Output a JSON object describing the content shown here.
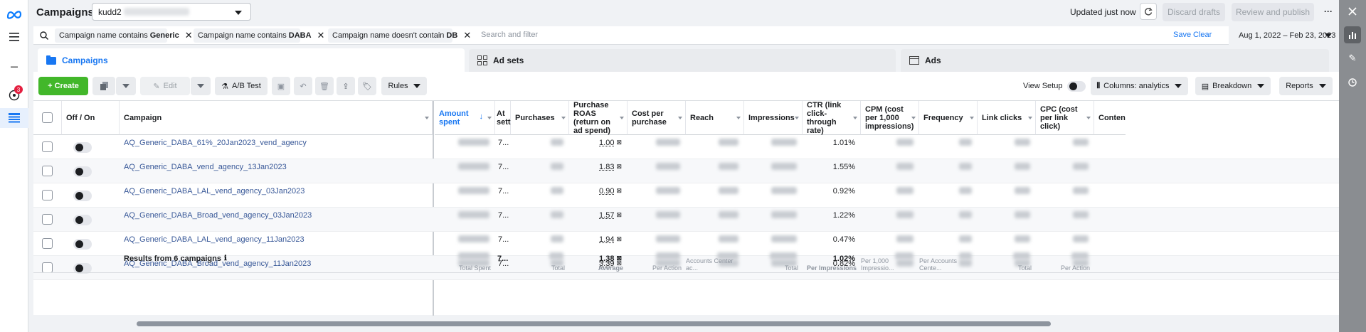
{
  "app": {
    "title": "Campaigns",
    "account": "kudd2",
    "updated": "Updated just now"
  },
  "actions": {
    "discard": "Discard drafts",
    "review": "Review and publish",
    "more": "···"
  },
  "filters": [
    {
      "prefix": "Campaign name contains",
      "value": "Generic"
    },
    {
      "prefix": "Campaign name contains",
      "value": "DABA"
    },
    {
      "prefix": "Campaign name doesn't contain",
      "value": "DB"
    }
  ],
  "search": {
    "placeholder": "Search and filter",
    "save": "Save",
    "clear": "Clear"
  },
  "date_range": "Aug 1, 2022 – Feb 23, 2023",
  "tabs": [
    "Campaigns",
    "Ad sets",
    "Ads"
  ],
  "toolbar": {
    "create": "+ Create",
    "edit": "Edit",
    "ab_test": "A/B Test",
    "rules": "Rules",
    "view_setup": "View Setup",
    "columns": "Columns: analytics",
    "breakdown": "Breakdown",
    "reports": "Reports"
  },
  "columns": {
    "off_on": "Off / On",
    "campaign": "Campaign",
    "amount_spent": "Amount spent",
    "attr": "At sett",
    "purchases": "Purchases",
    "roas": "Purchase ROAS (return on ad spend)",
    "cpp": "Cost per purchase",
    "reach": "Reach",
    "impressions": "Impressions",
    "ctr": "CTR (link click-through rate)",
    "cpm": "CPM (cost per 1,000 impressions)",
    "frequency": "Frequency",
    "link_clicks": "Link clicks",
    "cpc": "CPC (cost per link click)",
    "content_views": "Content vi"
  },
  "rows": [
    {
      "name": "AQ_Generic_DABA_61%_20Jan2023_vend_agency",
      "attr": "7...",
      "roas": "1.00",
      "ctr": "1.01%"
    },
    {
      "name": "AQ_Generic_DABA_vend_agency_13Jan2023",
      "attr": "7...",
      "roas": "1.83",
      "ctr": "1.55%"
    },
    {
      "name": "AQ_Generic_DABA_LAL_vend_agency_03Jan2023",
      "attr": "7...",
      "roas": "0.90",
      "ctr": "0.92%"
    },
    {
      "name": "AQ_Generic_DABA_Broad_vend_agency_03Jan2023",
      "attr": "7...",
      "roas": "1.57",
      "ctr": "1.22%"
    },
    {
      "name": "AQ_Generic_DABA_LAL_vend_agency_11Jan2023",
      "attr": "7...",
      "roas": "1.94",
      "ctr": "0.47%"
    },
    {
      "name": "AQ_Generic_DABA_Broad_vend_agency_11Jan2023",
      "attr": "7...",
      "roas": "3.39",
      "ctr": "0.82%"
    }
  ],
  "footer": {
    "label": "Results from 6 campaigns",
    "attr": "7...",
    "roas": "1.38",
    "ctr": "1.02%",
    "sub_spent": "Total Spent",
    "sub_purchases": "Total",
    "sub_roas": "Average",
    "sub_cpp": "Per Action",
    "sub_reach": "Accounts Center ac...",
    "sub_impr": "Total",
    "sub_ctr": "Per Impressions",
    "sub_cpm": "Per 1,000 Impressio...",
    "sub_freq": "Per Accounts Cente...",
    "sub_clicks": "Total",
    "sub_cpc": "Per Action"
  },
  "nav": {
    "badge": "3"
  },
  "colors": {
    "accent": "#1877f2",
    "create": "#42b72a",
    "badge": "#e41e3f"
  }
}
